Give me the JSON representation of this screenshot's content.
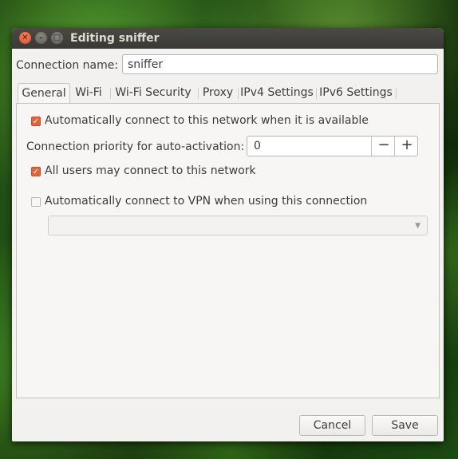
{
  "window": {
    "title": "Editing sniffer"
  },
  "titlebar": {
    "close_glyph": "✕",
    "minimize_glyph": "–",
    "maximize_glyph": "□"
  },
  "connection": {
    "label": "Connection name:",
    "value": "sniffer"
  },
  "tabs": [
    {
      "label": "General",
      "active": true
    },
    {
      "label": "Wi-Fi",
      "active": false
    },
    {
      "label": "Wi-Fi Security",
      "active": false
    },
    {
      "label": "Proxy",
      "active": false
    },
    {
      "label": "IPv4 Settings",
      "active": false
    },
    {
      "label": "IPv6 Settings",
      "active": false
    }
  ],
  "general": {
    "auto_connect": {
      "label": "Automatically connect to this network when it is available",
      "checked": true
    },
    "priority": {
      "label": "Connection priority for auto-activation:",
      "value": "0",
      "minus": "−",
      "plus": "+"
    },
    "all_users": {
      "label": "All users may connect to this network",
      "checked": true
    },
    "auto_vpn": {
      "label": "Automatically connect to VPN when using this connection",
      "checked": false
    },
    "vpn_select": {
      "value": "",
      "enabled": false
    }
  },
  "footer": {
    "cancel_label": "Cancel",
    "save_label": "Save"
  },
  "colors": {
    "accent": "#e2623a",
    "window_bg": "#f2f1f0",
    "titlebar": "#3c3b37"
  },
  "icons": {
    "checkmark": "check-icon",
    "dropdown": "chevron-down-icon"
  }
}
